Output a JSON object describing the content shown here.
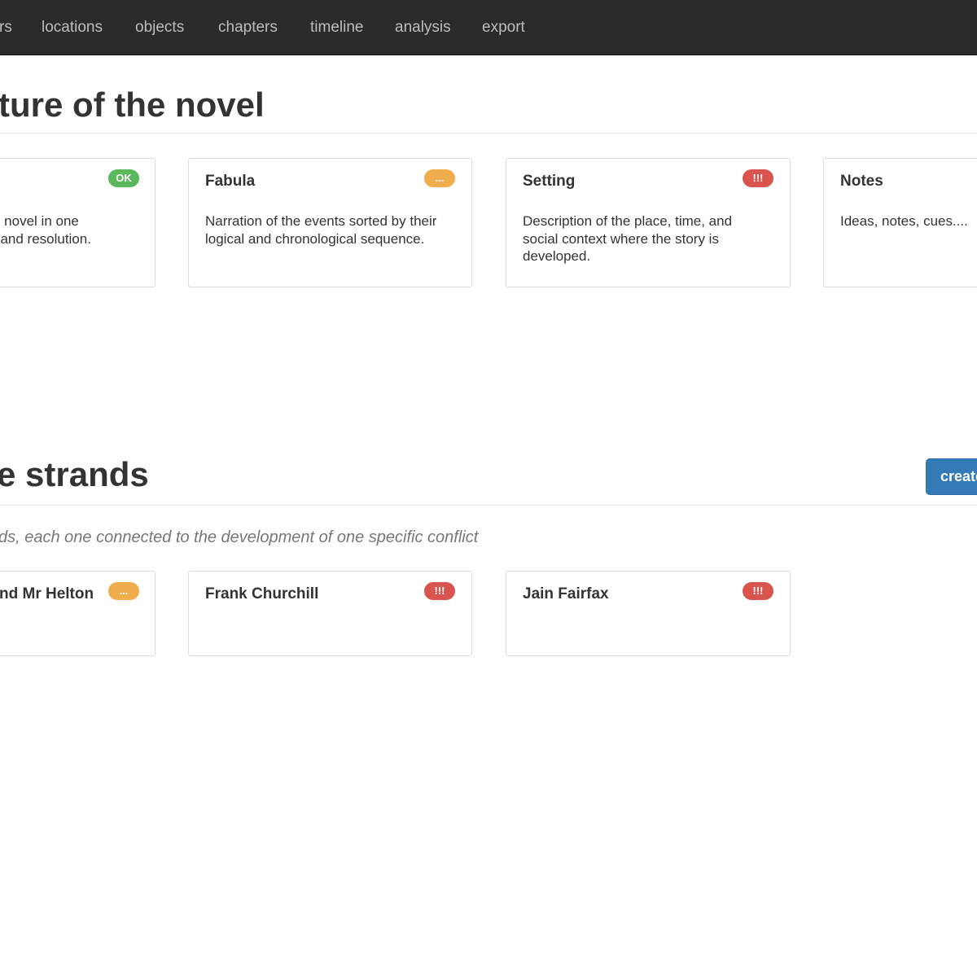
{
  "nav": {
    "items": [
      {
        "label": "rs"
      },
      {
        "label": "locations"
      },
      {
        "label": "objects"
      },
      {
        "label": "chapters"
      },
      {
        "label": "timeline"
      },
      {
        "label": "analysis"
      },
      {
        "label": "export"
      }
    ]
  },
  "structure": {
    "title": "ture of the novel",
    "cards": [
      {
        "title": "",
        "description": "e novel in one\nt and resolution.",
        "badge": "OK",
        "status": "ok"
      },
      {
        "title": "Fabula",
        "description": "Narration of the events sorted by their logical and chronological sequence.",
        "badge": "...",
        "status": "pending"
      },
      {
        "title": "Setting",
        "description": "Description of the place, time, and social context where the story is developed.",
        "badge": "!!!",
        "status": "error"
      },
      {
        "title": "Notes",
        "description": "Ideas, notes, cues....",
        "badge": "",
        "status": "none"
      }
    ]
  },
  "strands": {
    "title": "e strands",
    "create_label": "create",
    "description": "ds, each one connected to the development of one specific conflict",
    "cards": [
      {
        "title": "nd Mr Helton",
        "badge": "...",
        "status": "pending"
      },
      {
        "title": "Frank Churchill",
        "badge": "!!!",
        "status": "error"
      },
      {
        "title": "Jain Fairfax",
        "badge": "!!!",
        "status": "error"
      }
    ]
  },
  "colors": {
    "navbar_bg": "#2b2b2b",
    "primary": "#337ab7",
    "ok": "#5cb85c",
    "pending": "#f0ad4e",
    "error": "#d9534f"
  }
}
